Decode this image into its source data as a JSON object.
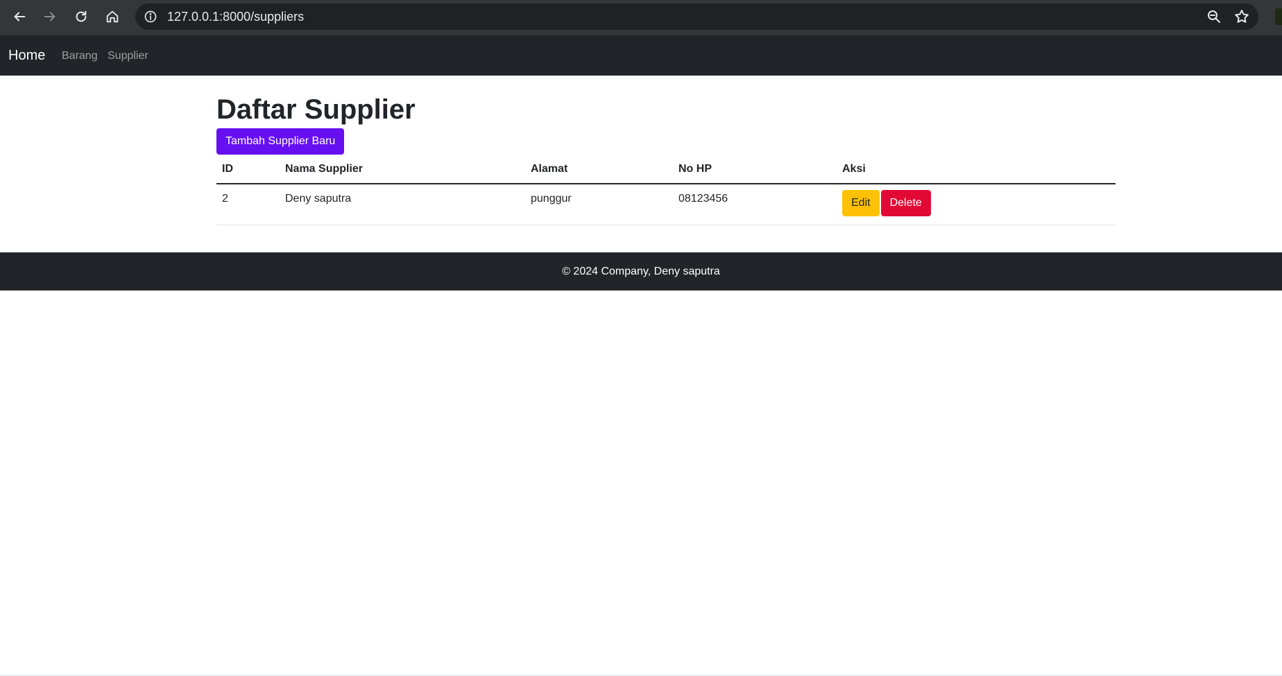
{
  "browser": {
    "url": "127.0.0.1:8000/suppliers"
  },
  "navbar": {
    "brand": "Home",
    "links": [
      {
        "label": "Barang"
      },
      {
        "label": "Supplier"
      }
    ]
  },
  "main": {
    "title": "Daftar Supplier",
    "add_button": "Tambah Supplier Baru",
    "table": {
      "headers": [
        "ID",
        "Nama Supplier",
        "Alamat",
        "No HP",
        "Aksi"
      ],
      "rows": [
        {
          "id": "2",
          "nama": "Deny saputra",
          "alamat": "punggur",
          "no_hp": "08123456",
          "edit_label": "Edit",
          "delete_label": "Delete"
        }
      ]
    }
  },
  "footer": {
    "text": "© 2024 Company, Deny saputra"
  },
  "colors": {
    "primary_button": "#6610f2",
    "edit_button": "#ffc107",
    "delete_button": "#e20a35",
    "navbar": "#212529"
  }
}
